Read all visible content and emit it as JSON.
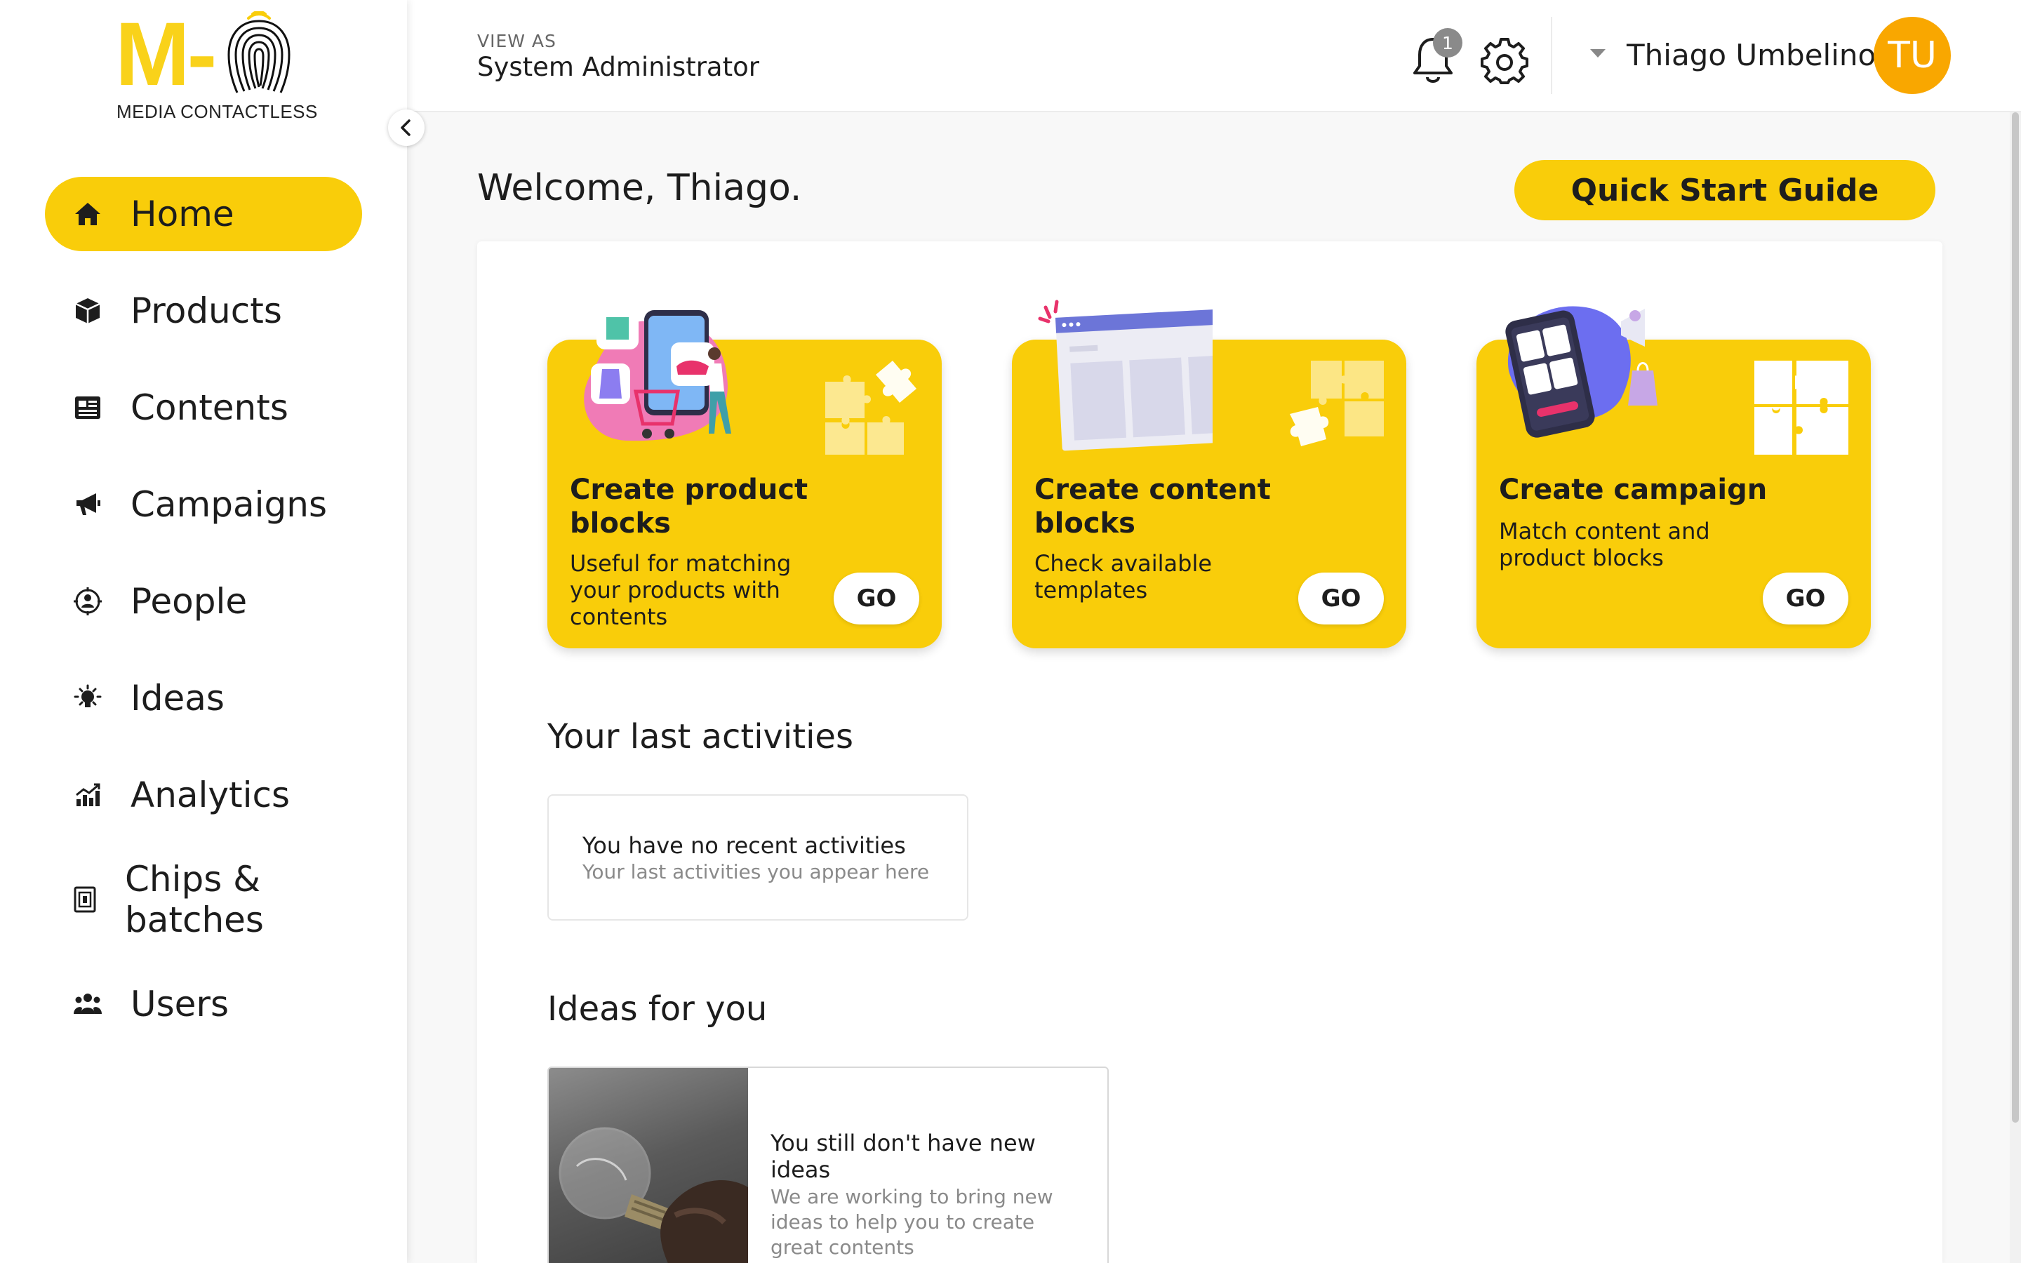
{
  "brand": {
    "logo_letters": "M-",
    "logo_subtitle": "MEDIA CONTACTLESS",
    "accent_color": "#f9cd0a"
  },
  "sidebar": {
    "collapse_icon": "chevron-left-icon",
    "items": [
      {
        "label": "Home",
        "icon": "home-icon",
        "active": true
      },
      {
        "label": "Products",
        "icon": "box-icon",
        "active": false
      },
      {
        "label": "Contents",
        "icon": "content-icon",
        "active": false
      },
      {
        "label": "Campaigns",
        "icon": "megaphone-icon",
        "active": false
      },
      {
        "label": "People",
        "icon": "person-target-icon",
        "active": false
      },
      {
        "label": "Ideas",
        "icon": "lightbulb-icon",
        "active": false
      },
      {
        "label": "Analytics",
        "icon": "chart-icon",
        "active": false
      },
      {
        "label": "Chips & batches",
        "icon": "chip-icon",
        "active": false
      },
      {
        "label": "Users",
        "icon": "users-icon",
        "active": false
      }
    ]
  },
  "header": {
    "view_as_label": "VIEW AS",
    "view_as_value": "System Administrator",
    "notification_count": "1",
    "user_name": "Thiago Umbelino",
    "user_initials": "TU",
    "avatar_color": "#f9a700"
  },
  "main": {
    "welcome": "Welcome, Thiago.",
    "quick_start_label": "Quick Start Guide",
    "cards": [
      {
        "title": "Create product blocks",
        "description": "Useful for matching your products with contents",
        "button": "GO"
      },
      {
        "title": "Create content blocks",
        "description": "Check available templates",
        "button": "GO"
      },
      {
        "title": "Create campaign",
        "description": "Match content and product blocks",
        "button": "GO"
      }
    ],
    "activities": {
      "title": "Your last activities",
      "empty_title": "You have no recent activities",
      "empty_subtitle": "Your last activities you appear here"
    },
    "ideas": {
      "title": "Ideas for you",
      "empty_title": "You still don't have new ideas",
      "empty_subtitle": "We are working to bring new ideas to help you to create great contents"
    }
  }
}
